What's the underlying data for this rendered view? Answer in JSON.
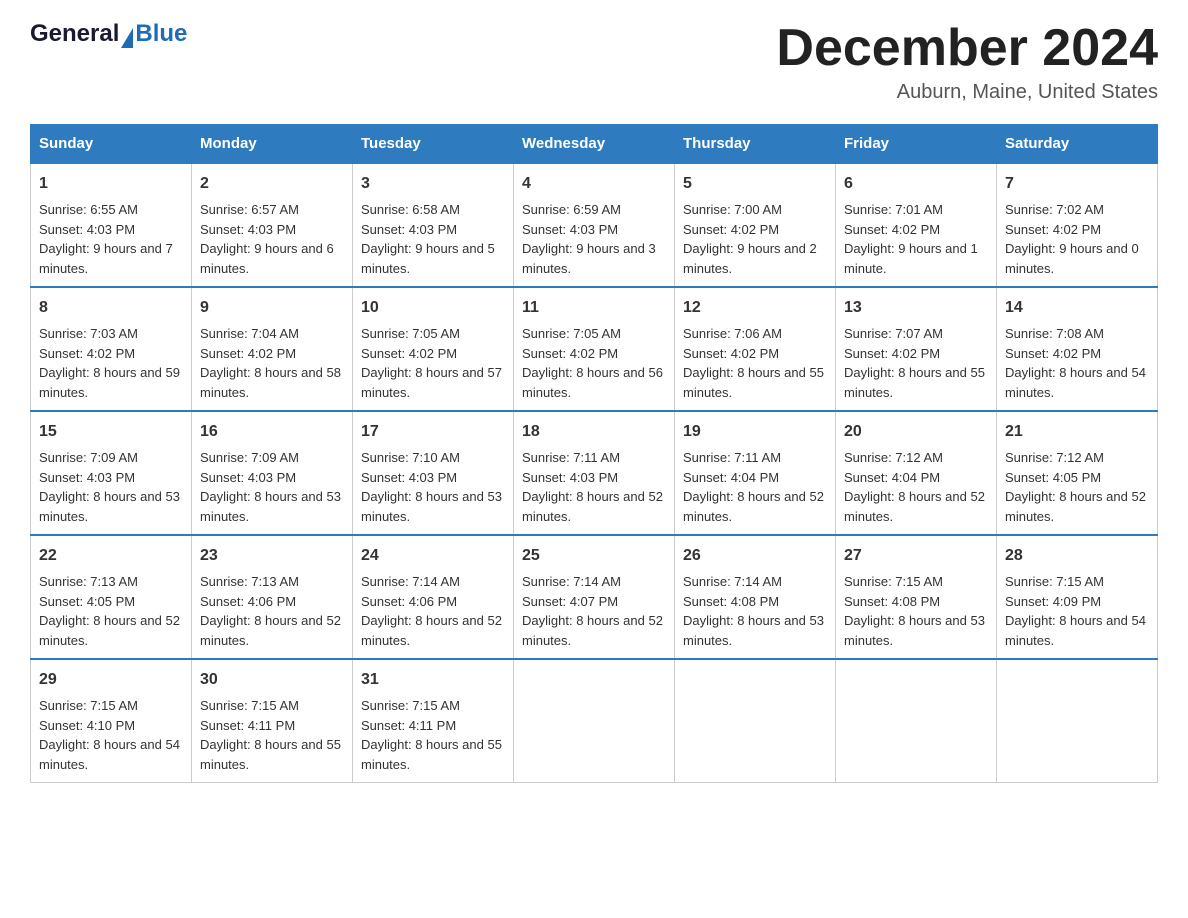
{
  "header": {
    "logo_general": "General",
    "logo_blue": "Blue",
    "month_title": "December 2024",
    "location": "Auburn, Maine, United States"
  },
  "days_of_week": [
    "Sunday",
    "Monday",
    "Tuesday",
    "Wednesday",
    "Thursday",
    "Friday",
    "Saturday"
  ],
  "weeks": [
    [
      {
        "day": "1",
        "sunrise": "6:55 AM",
        "sunset": "4:03 PM",
        "daylight": "9 hours and 7 minutes."
      },
      {
        "day": "2",
        "sunrise": "6:57 AM",
        "sunset": "4:03 PM",
        "daylight": "9 hours and 6 minutes."
      },
      {
        "day": "3",
        "sunrise": "6:58 AM",
        "sunset": "4:03 PM",
        "daylight": "9 hours and 5 minutes."
      },
      {
        "day": "4",
        "sunrise": "6:59 AM",
        "sunset": "4:03 PM",
        "daylight": "9 hours and 3 minutes."
      },
      {
        "day": "5",
        "sunrise": "7:00 AM",
        "sunset": "4:02 PM",
        "daylight": "9 hours and 2 minutes."
      },
      {
        "day": "6",
        "sunrise": "7:01 AM",
        "sunset": "4:02 PM",
        "daylight": "9 hours and 1 minute."
      },
      {
        "day": "7",
        "sunrise": "7:02 AM",
        "sunset": "4:02 PM",
        "daylight": "9 hours and 0 minutes."
      }
    ],
    [
      {
        "day": "8",
        "sunrise": "7:03 AM",
        "sunset": "4:02 PM",
        "daylight": "8 hours and 59 minutes."
      },
      {
        "day": "9",
        "sunrise": "7:04 AM",
        "sunset": "4:02 PM",
        "daylight": "8 hours and 58 minutes."
      },
      {
        "day": "10",
        "sunrise": "7:05 AM",
        "sunset": "4:02 PM",
        "daylight": "8 hours and 57 minutes."
      },
      {
        "day": "11",
        "sunrise": "7:05 AM",
        "sunset": "4:02 PM",
        "daylight": "8 hours and 56 minutes."
      },
      {
        "day": "12",
        "sunrise": "7:06 AM",
        "sunset": "4:02 PM",
        "daylight": "8 hours and 55 minutes."
      },
      {
        "day": "13",
        "sunrise": "7:07 AM",
        "sunset": "4:02 PM",
        "daylight": "8 hours and 55 minutes."
      },
      {
        "day": "14",
        "sunrise": "7:08 AM",
        "sunset": "4:02 PM",
        "daylight": "8 hours and 54 minutes."
      }
    ],
    [
      {
        "day": "15",
        "sunrise": "7:09 AM",
        "sunset": "4:03 PM",
        "daylight": "8 hours and 53 minutes."
      },
      {
        "day": "16",
        "sunrise": "7:09 AM",
        "sunset": "4:03 PM",
        "daylight": "8 hours and 53 minutes."
      },
      {
        "day": "17",
        "sunrise": "7:10 AM",
        "sunset": "4:03 PM",
        "daylight": "8 hours and 53 minutes."
      },
      {
        "day": "18",
        "sunrise": "7:11 AM",
        "sunset": "4:03 PM",
        "daylight": "8 hours and 52 minutes."
      },
      {
        "day": "19",
        "sunrise": "7:11 AM",
        "sunset": "4:04 PM",
        "daylight": "8 hours and 52 minutes."
      },
      {
        "day": "20",
        "sunrise": "7:12 AM",
        "sunset": "4:04 PM",
        "daylight": "8 hours and 52 minutes."
      },
      {
        "day": "21",
        "sunrise": "7:12 AM",
        "sunset": "4:05 PM",
        "daylight": "8 hours and 52 minutes."
      }
    ],
    [
      {
        "day": "22",
        "sunrise": "7:13 AM",
        "sunset": "4:05 PM",
        "daylight": "8 hours and 52 minutes."
      },
      {
        "day": "23",
        "sunrise": "7:13 AM",
        "sunset": "4:06 PM",
        "daylight": "8 hours and 52 minutes."
      },
      {
        "day": "24",
        "sunrise": "7:14 AM",
        "sunset": "4:06 PM",
        "daylight": "8 hours and 52 minutes."
      },
      {
        "day": "25",
        "sunrise": "7:14 AM",
        "sunset": "4:07 PM",
        "daylight": "8 hours and 52 minutes."
      },
      {
        "day": "26",
        "sunrise": "7:14 AM",
        "sunset": "4:08 PM",
        "daylight": "8 hours and 53 minutes."
      },
      {
        "day": "27",
        "sunrise": "7:15 AM",
        "sunset": "4:08 PM",
        "daylight": "8 hours and 53 minutes."
      },
      {
        "day": "28",
        "sunrise": "7:15 AM",
        "sunset": "4:09 PM",
        "daylight": "8 hours and 54 minutes."
      }
    ],
    [
      {
        "day": "29",
        "sunrise": "7:15 AM",
        "sunset": "4:10 PM",
        "daylight": "8 hours and 54 minutes."
      },
      {
        "day": "30",
        "sunrise": "7:15 AM",
        "sunset": "4:11 PM",
        "daylight": "8 hours and 55 minutes."
      },
      {
        "day": "31",
        "sunrise": "7:15 AM",
        "sunset": "4:11 PM",
        "daylight": "8 hours and 55 minutes."
      },
      null,
      null,
      null,
      null
    ]
  ]
}
